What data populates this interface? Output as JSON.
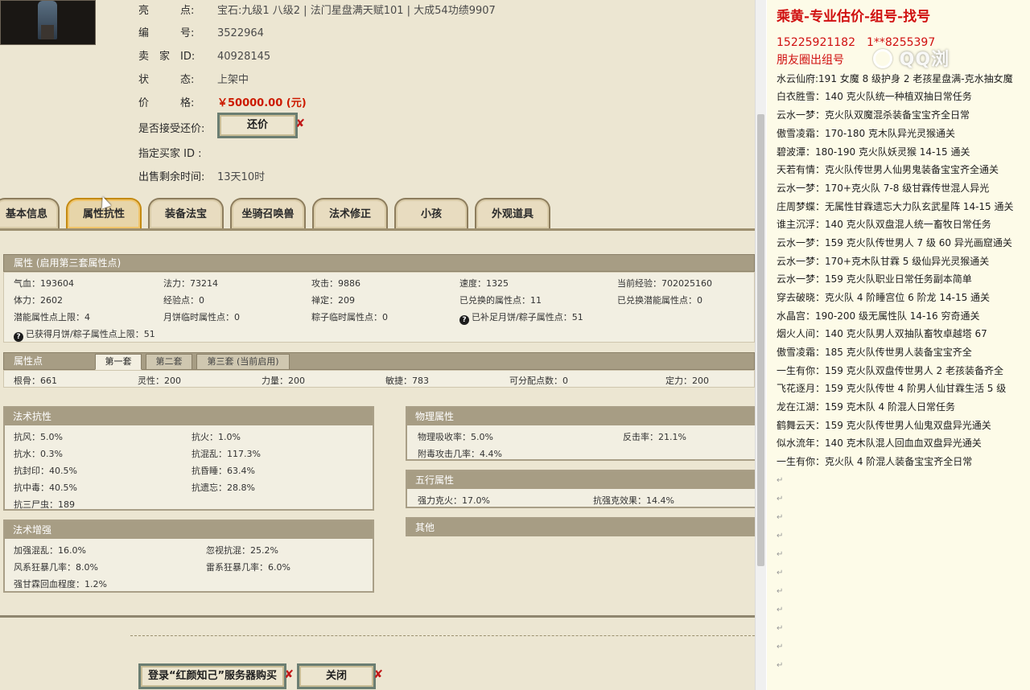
{
  "listing": {
    "rows": [
      {
        "label": "亮　　　点:",
        "value": "宝石:九级1 八级2 | 法门星盘满天赋101 | 大成54功绩9907"
      },
      {
        "label": "编　　　号:",
        "value": "3522964"
      },
      {
        "label": "卖　家　ID:",
        "value": "40928145"
      },
      {
        "label": "状　　　态:",
        "value": "上架中"
      },
      {
        "label": "价　　　格:",
        "value": "￥50000.00 (元)"
      },
      {
        "label": "是否接受还价:",
        "value": ""
      },
      {
        "label": "指定买家 ID :",
        "value": ""
      },
      {
        "label": "出售剩余时间:",
        "value": "13天10时"
      }
    ],
    "counter_offer_button": "还价"
  },
  "tabs": [
    "基本信息",
    "属性抗性",
    "装备法宝",
    "坐骑召唤兽",
    "法术修正",
    "小孩",
    "外观道具"
  ],
  "active_tab": "属性抗性",
  "attributes": {
    "title": "属性 (启用第三套属性点)",
    "rows": [
      [
        "气血：193604",
        "法力：73214",
        "攻击：9886",
        "速度：1325",
        "当前经验：702025160"
      ],
      [
        "体力：2602",
        "经验点：0",
        "禅定：209",
        "已兑换的属性点：11",
        "已兑换潜能属性点：0"
      ],
      [
        "潜能属性点上限：4",
        "月饼临时属性点：0",
        "粽子临时属性点：0",
        "已补足月饼/粽子属性点：51",
        ""
      ],
      [
        "已获得月饼/粽子属性点上限：51",
        "",
        "",
        "",
        ""
      ]
    ]
  },
  "points": {
    "title": "属性点",
    "subtabs": [
      "第一套",
      "第二套",
      "第三套 (当前启用)"
    ],
    "values": [
      "根骨：661",
      "灵性：200",
      "力量：200",
      "敏捷：783",
      "可分配点数：0",
      "定力：200"
    ]
  },
  "spell_resist": {
    "title": "法术抗性",
    "rows": [
      [
        "抗风：5.0%",
        "抗火：1.0%"
      ],
      [
        "抗水：0.3%",
        "抗混乱：117.3%"
      ],
      [
        "抗封印：40.5%",
        "抗昏睡：63.4%"
      ],
      [
        "抗中毒：40.5%",
        "抗遗忘：28.8%"
      ],
      [
        "抗三尸虫：189",
        ""
      ]
    ]
  },
  "spell_boost": {
    "title": "法术增强",
    "rows": [
      [
        "加强混乱：16.0%",
        "忽视抗混：25.2%"
      ],
      [
        "风系狂暴几率：8.0%",
        "雷系狂暴几率：6.0%"
      ],
      [
        "强甘霖回血程度：1.2%",
        ""
      ]
    ]
  },
  "physical": {
    "title": "物理属性",
    "rows": [
      [
        "物理吸收率：5.0%",
        "反击率：21.1%"
      ],
      [
        "附毒攻击几率：4.4%",
        ""
      ]
    ]
  },
  "five_elements": {
    "title": "五行属性",
    "rows": [
      [
        "强力克火：17.0%",
        "抗强克效果：14.4%"
      ]
    ]
  },
  "other": {
    "title": "其他"
  },
  "footer": {
    "login_button": "登录“红颜知己”服务器购买",
    "close_button": "关闭"
  },
  "doc": {
    "title": "乘黄-专业估价-组号-找号",
    "phone": "15225921182　1**8255397",
    "subtitle": "朋友圈出组号",
    "watermark": "QQ浏",
    "lines": [
      "水云仙府:191 女魔 8 级护身 2 老孩星盘满-克水抽女魔",
      "白衣胜雪：140 克火队统一种植双抽日常任务",
      "云水一梦：克火队双魔混杀装备宝宝齐全日常",
      "傲雪凌霜：170-180 克木队异光灵猴通关",
      "碧波潭：180-190 克火队妖灵猴 14-15 通关",
      "天若有情：克火队传世男人仙男鬼装备宝宝齐全通关",
      "云水一梦：170+克火队 7-8 级甘霖传世混人异光",
      "庄周梦蝶：无属性甘霖遗忘大力队玄武星阵 14-15 通关",
      "谁主沉浮：140 克火队双盘混人统一畜牧日常任务",
      "云水一梦：159 克火队传世男人 7 级 60 异光画窟通关",
      "云水一梦：170+克木队甘霖 5 级仙异光灵猴通关",
      "云水一梦：159 克火队职业日常任务副本简单",
      "穿去破晓：克火队 4 阶睡宫位 6 阶龙 14-15 通关",
      "水晶宫：190-200 级无属性队 14-16 穷奇通关",
      "烟火人间：140 克火队男人双抽队畜牧卓越塔 67",
      "傲雪凌霜：185 克火队传世男人装备宝宝齐全",
      "一生有你：159 克火队双盘传世男人 2 老孩装备齐全",
      "飞花逐月：159 克火队传世 4 阶男人仙甘霖生活 5 级",
      "龙在江湖：159 克木队 4 阶混人日常任务",
      "鹤舞云天：159 克火队传世男人仙鬼双盘异光通关",
      "似水流年：140 克木队混人回血血双盘异光通关",
      "一生有你：克火队 4 阶混人装备宝宝齐全日常"
    ],
    "para_mark": "↵"
  }
}
